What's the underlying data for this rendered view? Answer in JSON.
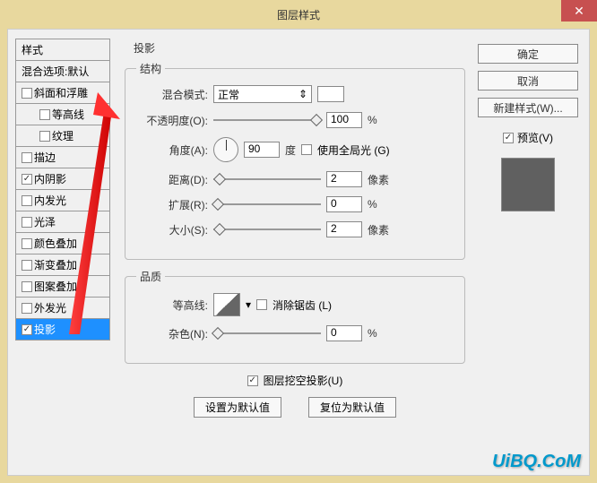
{
  "window": {
    "title": "图层样式"
  },
  "left": {
    "header": "样式",
    "blend_header": "混合选项:默认",
    "items": [
      {
        "label": "斜面和浮雕",
        "checked": false,
        "indent": false
      },
      {
        "label": "等高线",
        "checked": false,
        "indent": true
      },
      {
        "label": "纹理",
        "checked": false,
        "indent": true
      },
      {
        "label": "描边",
        "checked": false,
        "indent": false
      },
      {
        "label": "内阴影",
        "checked": true,
        "indent": false
      },
      {
        "label": "内发光",
        "checked": false,
        "indent": false
      },
      {
        "label": "光泽",
        "checked": false,
        "indent": false
      },
      {
        "label": "颜色叠加",
        "checked": false,
        "indent": false
      },
      {
        "label": "渐变叠加",
        "checked": false,
        "indent": false
      },
      {
        "label": "图案叠加",
        "checked": false,
        "indent": false
      },
      {
        "label": "外发光",
        "checked": false,
        "indent": false
      },
      {
        "label": "投影",
        "checked": true,
        "indent": false,
        "selected": true
      }
    ]
  },
  "center": {
    "panel_title": "投影",
    "structure": {
      "legend": "结构",
      "blend_mode_label": "混合模式:",
      "blend_mode_value": "正常",
      "opacity_label": "不透明度(O):",
      "opacity_value": "100",
      "opacity_unit": "%",
      "angle_label": "角度(A):",
      "angle_value": "90",
      "angle_unit": "度",
      "global_light_label": "使用全局光 (G)",
      "distance_label": "距离(D):",
      "distance_value": "2",
      "distance_unit": "像素",
      "spread_label": "扩展(R):",
      "spread_value": "0",
      "spread_unit": "%",
      "size_label": "大小(S):",
      "size_value": "2",
      "size_unit": "像素"
    },
    "quality": {
      "legend": "品质",
      "contour_label": "等高线:",
      "antialias_label": "消除锯齿 (L)",
      "noise_label": "杂色(N):",
      "noise_value": "0",
      "noise_unit": "%"
    },
    "knockout_label": "图层挖空投影(U)",
    "set_default": "设置为默认值",
    "reset_default": "复位为默认值"
  },
  "right": {
    "ok": "确定",
    "cancel": "取消",
    "new_style": "新建样式(W)...",
    "preview_label": "预览(V)"
  },
  "watermark": "UiBQ.CoM"
}
